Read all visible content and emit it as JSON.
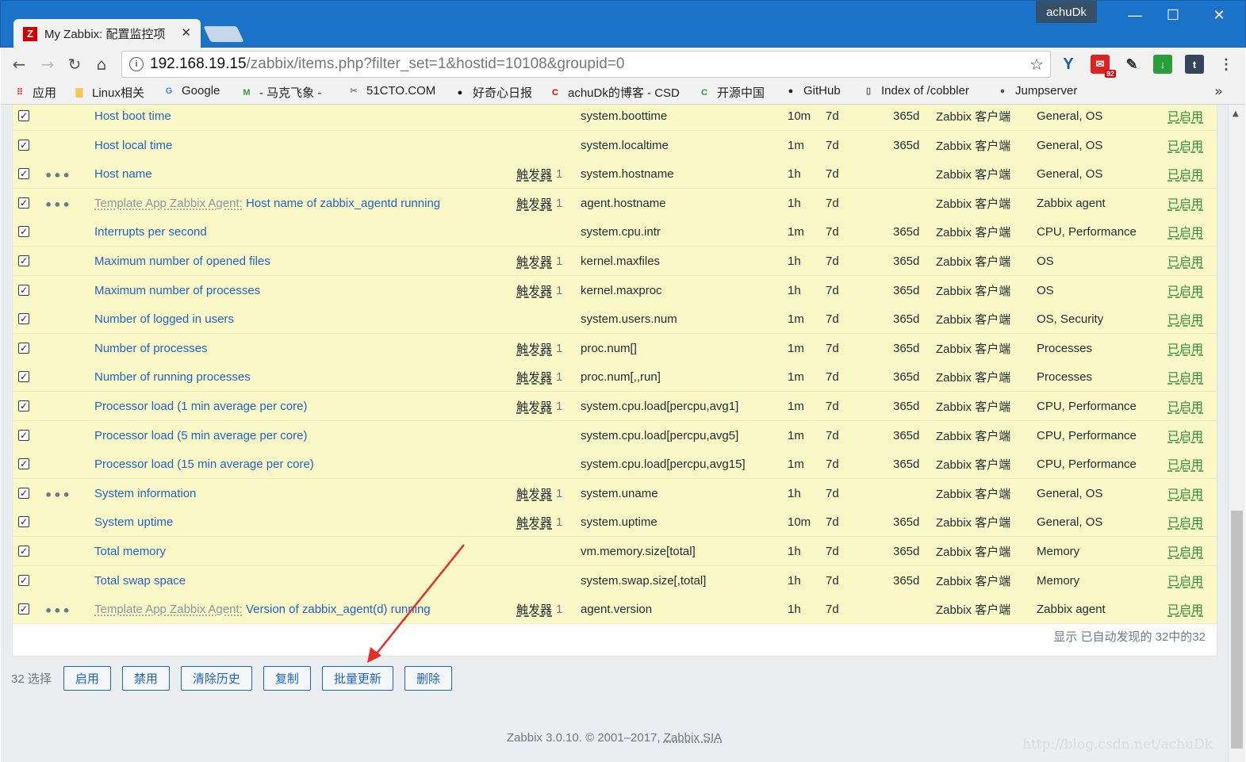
{
  "browser": {
    "tab_title": "My Zabbix: 配置监控项",
    "tab_logo": "Z",
    "user": "achuDk",
    "url_host": "192.168.19.15",
    "url_path": "/zabbix/items.php?filter_set=1&hostid=10108&groupid=0",
    "ext_badge": "92",
    "bookmarks": [
      {
        "label": "应用",
        "icon": "apps-grid-icon"
      },
      {
        "label": "Linux相关",
        "icon": "folder-icon"
      },
      {
        "label": "Google",
        "icon": "google-icon"
      },
      {
        "label": "- 马克飞象 -",
        "icon": "maxiang-icon"
      },
      {
        "label": "51CTO.COM",
        "icon": "51cto-icon"
      },
      {
        "label": "好奇心日报",
        "icon": "qdaily-icon"
      },
      {
        "label": "achuDk的博客 - CSD",
        "icon": "csdn-icon"
      },
      {
        "label": "开源中国",
        "icon": "oschina-icon"
      },
      {
        "label": "GitHub",
        "icon": "github-icon"
      },
      {
        "label": "Index of /cobbler",
        "icon": "page-icon"
      },
      {
        "label": "Jumpserver",
        "icon": "jumpserver-icon"
      }
    ]
  },
  "items_table": {
    "rows": [
      {
        "template": "",
        "name": "Host boot time",
        "wizard": false,
        "trigger": "",
        "trigger_count": "",
        "key": "system.boottime",
        "interval": "10m",
        "history": "7d",
        "trends": "365d",
        "type": "Zabbix 客户端",
        "apps": "General, OS",
        "status": "已启用"
      },
      {
        "template": "",
        "name": "Host local time",
        "wizard": false,
        "trigger": "",
        "trigger_count": "",
        "key": "system.localtime",
        "interval": "1m",
        "history": "7d",
        "trends": "365d",
        "type": "Zabbix 客户端",
        "apps": "General, OS",
        "status": "已启用"
      },
      {
        "template": "",
        "name": "Host name",
        "wizard": true,
        "trigger": "触发器",
        "trigger_count": "1",
        "key": "system.hostname",
        "interval": "1h",
        "history": "7d",
        "trends": "",
        "type": "Zabbix 客户端",
        "apps": "General, OS",
        "status": "已启用"
      },
      {
        "template": "Template App Zabbix Agent:",
        "name": "Host name of zabbix_agentd running",
        "wizard": true,
        "trigger": "触发器",
        "trigger_count": "1",
        "key": "agent.hostname",
        "interval": "1h",
        "history": "7d",
        "trends": "",
        "type": "Zabbix 客户端",
        "apps": "Zabbix agent",
        "status": "已启用"
      },
      {
        "template": "",
        "name": "Interrupts per second",
        "wizard": false,
        "trigger": "",
        "trigger_count": "",
        "key": "system.cpu.intr",
        "interval": "1m",
        "history": "7d",
        "trends": "365d",
        "type": "Zabbix 客户端",
        "apps": "CPU, Performance",
        "status": "已启用"
      },
      {
        "template": "",
        "name": "Maximum number of opened files",
        "wizard": false,
        "trigger": "触发器",
        "trigger_count": "1",
        "key": "kernel.maxfiles",
        "interval": "1h",
        "history": "7d",
        "trends": "365d",
        "type": "Zabbix 客户端",
        "apps": "OS",
        "status": "已启用"
      },
      {
        "template": "",
        "name": "Maximum number of processes",
        "wizard": false,
        "trigger": "触发器",
        "trigger_count": "1",
        "key": "kernel.maxproc",
        "interval": "1h",
        "history": "7d",
        "trends": "365d",
        "type": "Zabbix 客户端",
        "apps": "OS",
        "status": "已启用"
      },
      {
        "template": "",
        "name": "Number of logged in users",
        "wizard": false,
        "trigger": "",
        "trigger_count": "",
        "key": "system.users.num",
        "interval": "1m",
        "history": "7d",
        "trends": "365d",
        "type": "Zabbix 客户端",
        "apps": "OS, Security",
        "status": "已启用"
      },
      {
        "template": "",
        "name": "Number of processes",
        "wizard": false,
        "trigger": "触发器",
        "trigger_count": "1",
        "key": "proc.num[]",
        "interval": "1m",
        "history": "7d",
        "trends": "365d",
        "type": "Zabbix 客户端",
        "apps": "Processes",
        "status": "已启用"
      },
      {
        "template": "",
        "name": "Number of running processes",
        "wizard": false,
        "trigger": "触发器",
        "trigger_count": "1",
        "key": "proc.num[,,run]",
        "interval": "1m",
        "history": "7d",
        "trends": "365d",
        "type": "Zabbix 客户端",
        "apps": "Processes",
        "status": "已启用"
      },
      {
        "template": "",
        "name": "Processor load (1 min average per core)",
        "wizard": false,
        "trigger": "触发器",
        "trigger_count": "1",
        "key": "system.cpu.load[percpu,avg1]",
        "interval": "1m",
        "history": "7d",
        "trends": "365d",
        "type": "Zabbix 客户端",
        "apps": "CPU, Performance",
        "status": "已启用"
      },
      {
        "template": "",
        "name": "Processor load (5 min average per core)",
        "wizard": false,
        "trigger": "",
        "trigger_count": "",
        "key": "system.cpu.load[percpu,avg5]",
        "interval": "1m",
        "history": "7d",
        "trends": "365d",
        "type": "Zabbix 客户端",
        "apps": "CPU, Performance",
        "status": "已启用"
      },
      {
        "template": "",
        "name": "Processor load (15 min average per core)",
        "wizard": false,
        "trigger": "",
        "trigger_count": "",
        "key": "system.cpu.load[percpu,avg15]",
        "interval": "1m",
        "history": "7d",
        "trends": "365d",
        "type": "Zabbix 客户端",
        "apps": "CPU, Performance",
        "status": "已启用"
      },
      {
        "template": "",
        "name": "System information",
        "wizard": true,
        "trigger": "触发器",
        "trigger_count": "1",
        "key": "system.uname",
        "interval": "1h",
        "history": "7d",
        "trends": "",
        "type": "Zabbix 客户端",
        "apps": "General, OS",
        "status": "已启用"
      },
      {
        "template": "",
        "name": "System uptime",
        "wizard": false,
        "trigger": "触发器",
        "trigger_count": "1",
        "key": "system.uptime",
        "interval": "10m",
        "history": "7d",
        "trends": "365d",
        "type": "Zabbix 客户端",
        "apps": "General, OS",
        "status": "已启用"
      },
      {
        "template": "",
        "name": "Total memory",
        "wizard": false,
        "trigger": "",
        "trigger_count": "",
        "key": "vm.memory.size[total]",
        "interval": "1h",
        "history": "7d",
        "trends": "365d",
        "type": "Zabbix 客户端",
        "apps": "Memory",
        "status": "已启用"
      },
      {
        "template": "",
        "name": "Total swap space",
        "wizard": false,
        "trigger": "",
        "trigger_count": "",
        "key": "system.swap.size[,total]",
        "interval": "1h",
        "history": "7d",
        "trends": "365d",
        "type": "Zabbix 客户端",
        "apps": "Memory",
        "status": "已启用"
      },
      {
        "template": "Template App Zabbix Agent:",
        "name": "Version of zabbix_agent(d) running",
        "wizard": true,
        "trigger": "触发器",
        "trigger_count": "1",
        "key": "agent.version",
        "interval": "1h",
        "history": "7d",
        "trends": "",
        "type": "Zabbix 客户端",
        "apps": "Zabbix agent",
        "status": "已启用"
      }
    ],
    "summary": "显示 已自动发现的 32中的32"
  },
  "actions": {
    "selected_count": "32 选择",
    "buttons": [
      "启用",
      "禁用",
      "清除历史",
      "复制",
      "批量更新",
      "删除"
    ]
  },
  "footer": {
    "copyright": "Zabbix 3.0.10. © 2001–2017,",
    "company": "Zabbix SIA"
  },
  "watermark": "http://blog.csdn.net/achuDk",
  "colors": {
    "row_bg": "#fbf8c7",
    "link": "#1f65c0",
    "status_enabled": "#2e8b3a",
    "annotation_arrow": "#e0312a",
    "titlebar": "#1a73c8"
  }
}
